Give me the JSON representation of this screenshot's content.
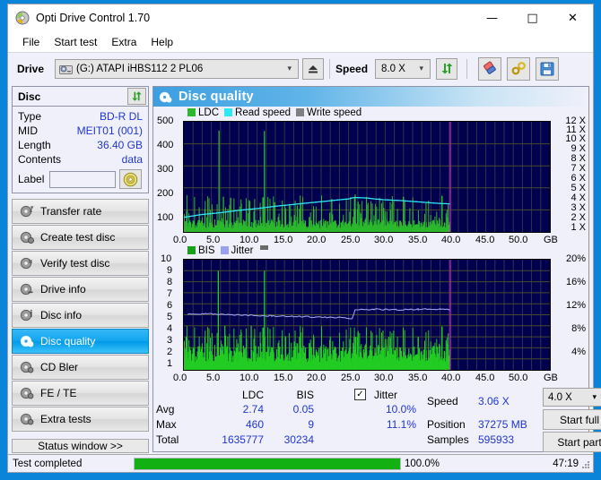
{
  "window": {
    "title": "Opti Drive Control 1.70",
    "icon": "disc-icon",
    "minimize": "—",
    "maximize": "□",
    "close": "✕"
  },
  "menubar": {
    "items": [
      {
        "label": "File"
      },
      {
        "label": "Start test"
      },
      {
        "label": "Extra"
      },
      {
        "label": "Help"
      }
    ]
  },
  "toolbar": {
    "drive_label": "Drive",
    "drive_value": "(G:)  ATAPI iHBS112  2 PL06",
    "eject_icon": "eject-icon",
    "speed_label": "Speed",
    "speed_value": "8.0 X",
    "refresh_icon": "refresh-icon",
    "eraser_icon": "eraser-icon",
    "tools_icon": "tools-icon",
    "save_icon": "save-icon"
  },
  "disc": {
    "header": "Disc",
    "refresh_icon": "refresh-icon",
    "rows": [
      {
        "key": "Type",
        "value": "BD-R DL"
      },
      {
        "key": "MID",
        "value": "MEIT01 (001)"
      },
      {
        "key": "Length",
        "value": "36.40 GB"
      },
      {
        "key": "Contents",
        "value": "data"
      }
    ],
    "label_key": "Label",
    "label_value": "",
    "label_placeholder": "",
    "label_button_icon": "cd-icon"
  },
  "nav": {
    "items": [
      {
        "label": "Transfer rate",
        "icon": "disc-rate-icon",
        "selected": false
      },
      {
        "label": "Create test disc",
        "icon": "disc-create-icon",
        "selected": false
      },
      {
        "label": "Verify test disc",
        "icon": "disc-verify-icon",
        "selected": false
      },
      {
        "label": "Drive info",
        "icon": "disc-drive-icon",
        "selected": false
      },
      {
        "label": "Disc info",
        "icon": "disc-info-icon",
        "selected": false
      },
      {
        "label": "Disc quality",
        "icon": "disc-quality-icon",
        "selected": true
      },
      {
        "label": "CD Bler",
        "icon": "disc-bler-icon",
        "selected": false
      },
      {
        "label": "FE / TE",
        "icon": "disc-fete-icon",
        "selected": false
      },
      {
        "label": "Extra tests",
        "icon": "disc-extra-icon",
        "selected": false
      }
    ],
    "status_window_button": "Status window >>"
  },
  "content": {
    "header": "Disc quality",
    "header_icon": "disc-quality-icon"
  },
  "stats": {
    "col_ldc": "LDC",
    "col_bis": "BIS",
    "row_avg": "Avg",
    "row_max": "Max",
    "row_total": "Total",
    "ldc_avg": "2.74",
    "ldc_max": "460",
    "ldc_total": "1635777",
    "bis_avg": "0.05",
    "bis_max": "9",
    "bis_total": "30234",
    "jitter_label": "Jitter",
    "jitter_checked": true,
    "jitter_check_glyph": "✓",
    "jitter_avg": "10.0%",
    "jitter_max": "11.1%",
    "speed_label": "Speed",
    "speed_value": "3.06 X",
    "position_label": "Position",
    "position_value": "37275 MB",
    "samples_label": "Samples",
    "samples_value": "595933",
    "speed_select": "4.0 X",
    "start_full": "Start full",
    "start_part": "Start part"
  },
  "statusbar": {
    "text": "Test completed",
    "percent_label": "100.0%",
    "percent": 100,
    "time": "47:19"
  },
  "colors": {
    "accent": "#0a84d8",
    "plot_bg": "#00004e",
    "ldc_green": "#2db82d",
    "bis_green": "#22cc22",
    "read_speed": "#2fe8f5",
    "write_speed": "#808080",
    "jitter": "#9aa0ee",
    "marker_magenta": "#cc22cc",
    "value_blue": "#2036d0",
    "progress_green": "#13b013"
  },
  "chart_data": [
    {
      "type": "line",
      "name": "LDC / Read speed chart",
      "title": "Disc quality",
      "xlabel": "GB",
      "ylabel": "LDC",
      "y2label": "Speed (X)",
      "xlim": [
        0,
        50
      ],
      "ylim": [
        0,
        500
      ],
      "y2lim": [
        0,
        12
      ],
      "xticks": [
        "0.0",
        "5.0",
        "10.0",
        "15.0",
        "20.0",
        "25.0",
        "30.0",
        "35.0",
        "40.0",
        "45.0",
        "50.0"
      ],
      "xtick_suffix": "GB",
      "yticks": [
        "100",
        "200",
        "300",
        "400",
        "500"
      ],
      "y2ticks": [
        "1 X",
        "2 X",
        "3 X",
        "4 X",
        "5 X",
        "6 X",
        "7 X",
        "8 X",
        "9 X",
        "10 X",
        "11 X",
        "12 X"
      ],
      "grid": true,
      "legend": [
        {
          "label": "LDC",
          "color": "#2db82d"
        },
        {
          "label": "Read speed",
          "color": "#2fe8f5"
        },
        {
          "label": "Write speed",
          "color": "#808080"
        }
      ],
      "series": [
        {
          "name": "Read speed",
          "color": "#2fe8f5",
          "unit": "X",
          "x": [
            0.0,
            2.5,
            5.0,
            7.5,
            10.0,
            12.5,
            15.0,
            17.5,
            20.0,
            22.5,
            23.2,
            25.0,
            26.0,
            27.5,
            30.0,
            32.5,
            35.0,
            36.4
          ],
          "y": [
            1.6,
            1.9,
            2.1,
            2.35,
            2.55,
            2.8,
            3.0,
            3.2,
            3.4,
            3.6,
            3.75,
            3.7,
            3.6,
            3.5,
            3.4,
            3.25,
            3.1,
            3.06
          ]
        },
        {
          "name": "LDC",
          "color": "#2db82d",
          "unit": "errors",
          "avg": 2.74,
          "max": 460,
          "total": 1635777,
          "baseline": 40,
          "spikes": [
            {
              "x": 4.8,
              "y": 460
            },
            {
              "x": 11.0,
              "y": 458
            },
            {
              "x": 5.4,
              "y": 160
            },
            {
              "x": 6.4,
              "y": 155
            },
            {
              "x": 9.0,
              "y": 140
            },
            {
              "x": 12.4,
              "y": 135
            },
            {
              "x": 15.5,
              "y": 120
            },
            {
              "x": 20.2,
              "y": 150
            },
            {
              "x": 23.4,
              "y": 170
            },
            {
              "x": 30.0,
              "y": 160
            }
          ]
        }
      ],
      "markers": [
        {
          "type": "vline",
          "x": 36.4,
          "color": "#cc22cc"
        }
      ],
      "data_end_x": 36.4
    },
    {
      "type": "line",
      "name": "BIS / Jitter chart",
      "xlabel": "GB",
      "ylabel": "BIS",
      "y2label": "Jitter (%)",
      "xlim": [
        0,
        50
      ],
      "ylim": [
        0,
        10
      ],
      "y2lim": [
        0,
        20
      ],
      "xticks": [
        "0.0",
        "5.0",
        "10.0",
        "15.0",
        "20.0",
        "25.0",
        "30.0",
        "35.0",
        "40.0",
        "45.0",
        "50.0"
      ],
      "xtick_suffix": "GB",
      "yticks": [
        "1",
        "2",
        "3",
        "4",
        "5",
        "6",
        "7",
        "8",
        "9",
        "10"
      ],
      "y2ticks": [
        "4%",
        "8%",
        "12%",
        "16%",
        "20%"
      ],
      "grid": true,
      "legend": [
        {
          "label": "BIS",
          "color": "#22cc22"
        },
        {
          "label": "Jitter",
          "color": "#9aa0ee"
        }
      ],
      "series": [
        {
          "name": "Jitter",
          "color": "#9aa0ee",
          "unit": "%",
          "avg": 10.0,
          "max": 11.1,
          "x": [
            0.5,
            3.0,
            6.0,
            9.0,
            12.0,
            15.0,
            18.0,
            21.0,
            23.0,
            23.4,
            26.0,
            29.0,
            32.0,
            35.0,
            36.4
          ],
          "y": [
            10.1,
            10.2,
            10.0,
            9.9,
            9.8,
            9.7,
            9.6,
            9.5,
            9.3,
            10.9,
            11.0,
            10.9,
            11.0,
            11.0,
            10.9
          ]
        },
        {
          "name": "BIS",
          "color": "#22cc22",
          "unit": "errors",
          "avg": 0.05,
          "max": 9,
          "total": 30234,
          "baseline": 1.6,
          "spikes": [
            {
              "x": 4.7,
              "y": 9
            },
            {
              "x": 11.0,
              "y": 9
            },
            {
              "x": 0.3,
              "y": 3
            },
            {
              "x": 5.6,
              "y": 4
            },
            {
              "x": 9.2,
              "y": 4
            },
            {
              "x": 20.0,
              "y": 3
            },
            {
              "x": 23.5,
              "y": 3
            },
            {
              "x": 28.0,
              "y": 3
            },
            {
              "x": 32.0,
              "y": 3
            }
          ]
        }
      ],
      "markers": [
        {
          "type": "vline",
          "x": 36.4,
          "color": "#cc22cc"
        }
      ],
      "data_end_x": 36.4
    }
  ]
}
